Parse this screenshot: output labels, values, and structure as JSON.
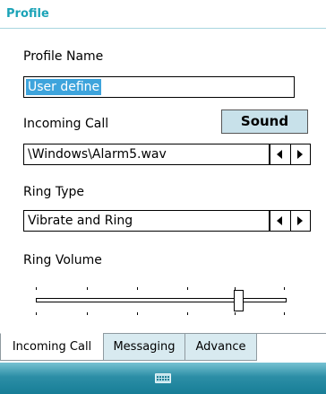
{
  "title": "Profile",
  "profile_name": {
    "label": "Profile Name",
    "value": "User define"
  },
  "incoming_call": {
    "label": "Incoming Call",
    "sound_button": "Sound",
    "value": "\\Windows\\Alarm5.wav"
  },
  "ring_type": {
    "label": "Ring Type",
    "value": "Vibrate and Ring"
  },
  "ring_volume": {
    "label": "Ring Volume",
    "level_fraction": 0.8
  },
  "tabs": [
    {
      "label": "Incoming Call",
      "active": true
    },
    {
      "label": "Messaging",
      "active": false
    },
    {
      "label": "Advance",
      "active": false
    }
  ],
  "taskbar": {
    "icon": "keyboard-icon"
  },
  "colors": {
    "title": "#1ba3b7",
    "selection": "#3ea4dc",
    "button_bg": "#c8e1ea",
    "taskbar": "#177e97"
  }
}
